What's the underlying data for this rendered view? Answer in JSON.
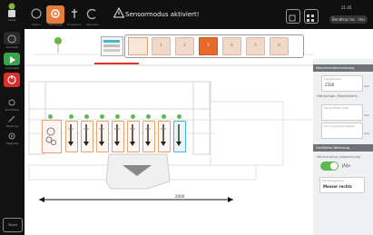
{
  "sidebar": {
    "top_label": "Laden",
    "items": [
      {
        "label": "Kontrolle",
        "icon": "info-icon"
      },
      {
        "label": "Automatik",
        "icon": "play-icon"
      },
      {
        "label": "",
        "icon": "power-icon"
      },
      {
        "label": "Einrichten",
        "icon": "gear-icon"
      },
      {
        "label": "Wartung",
        "icon": "wrench-icon"
      },
      {
        "label": "Diagnose",
        "icon": "diagnostic-icon"
      }
    ],
    "bottom_label": "Touch"
  },
  "topbar": {
    "buttons": [
      {
        "label": "Status",
        "icon": "clock-icon"
      },
      {
        "label": "Werkzeug",
        "icon": "gear-icon"
      },
      {
        "label": "Programm",
        "icon": "tool-icon"
      },
      {
        "label": "Beenden",
        "icon": "exit-icon"
      }
    ],
    "warning": "Sensormodus aktiviert!",
    "right_buttons": [
      {
        "label": "Fenster",
        "icon": "window-icon"
      },
      {
        "label": "Menü",
        "icon": "menu-icon"
      }
    ],
    "time": "21:45",
    "pill": "Bendtrac Inc · Hal"
  },
  "stations": {
    "numbers": [
      "1",
      "2",
      "3",
      "4",
      "5",
      "6"
    ],
    "active_index": 2
  },
  "dimension": "2000",
  "panel": {
    "title": "Maschinenbeschreibung",
    "field1_caption": "Arbeitsbreite",
    "field1_value": "2500",
    "field1_unit": "mm",
    "section2_label": "Höhenlage (Stabilisiert)",
    "field2_caption": "Länge EMM-Achse",
    "field2_unit": "mm",
    "field3_caption": "Hoch-Geschwindigkeit",
    "field3_unit": "mm",
    "section3_title": "Gewähltes Werkzeug",
    "section3_label": "Werkzeugtyp (abgewendig)",
    "toggle_label": "JA/Ja",
    "toggle_on": true,
    "field4_caption": "Werkzeugbezug",
    "field4_value": "Messer rechts"
  },
  "colors": {
    "accent": "#e76a2d",
    "selected": "#49b4d4",
    "ok": "#5cba4e",
    "warning": "#e0302a"
  }
}
